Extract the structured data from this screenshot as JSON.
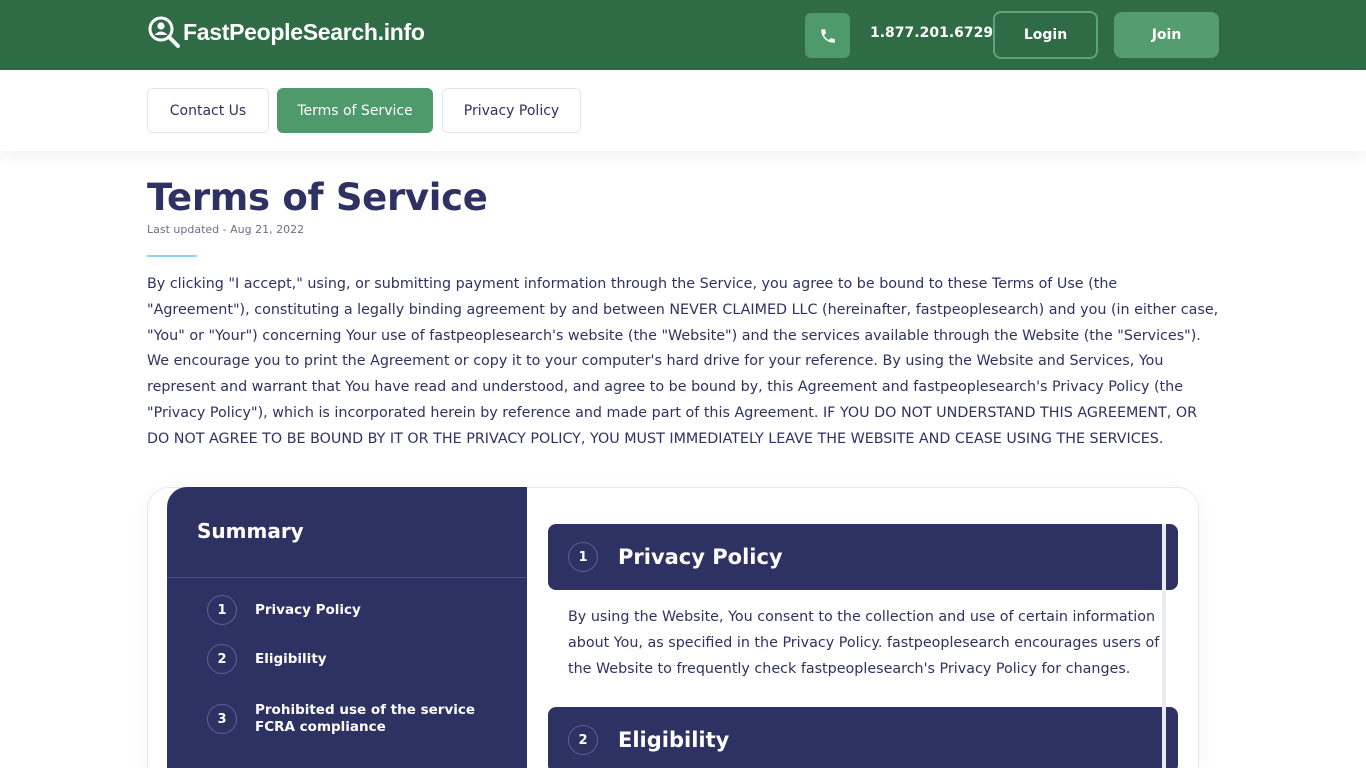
{
  "header": {
    "logo_text": "FastPeopleSearch.info",
    "phone": "1.877.201.6729",
    "login_label": "Login",
    "join_label": "Join",
    "colors": {
      "bg": "#2f6b45",
      "accent": "#4e9a6b"
    }
  },
  "subnav": {
    "tabs": [
      {
        "label": "Contact Us",
        "active": false
      },
      {
        "label": "Terms of Service",
        "active": true
      },
      {
        "label": "Privacy Policy",
        "active": false
      }
    ]
  },
  "content": {
    "title": "Terms of Service",
    "updated": "Last updated - Aug 21, 2022",
    "intro": "By clicking \"I accept,\" using, or submitting payment information through the Service, you agree to be bound to these Terms of Use (the \"Agreement\"), constituting a legally binding agreement by and between NEVER CLAIMED LLC (hereinafter, fastpeoplesearch) and you (in either case, \"You\" or \"Your\") concerning Your use of fastpeoplesearch's website (the \"Website\") and the services available through the Website (the \"Services\"). We encourage you to print the Agreement or copy it to your computer's hard drive for your reference. By using the Website and Services, You represent and warrant that You have read and understood, and agree to be bound by, this Agreement and fastpeoplesearch's Privacy Policy (the \"Privacy Policy\"), which is incorporated herein by reference and made part of this Agreement. IF YOU DO NOT UNDERSTAND THIS AGREEMENT, OR DO NOT AGREE TO BE BOUND BY IT OR THE PRIVACY POLICY, YOU MUST IMMEDIATELY LEAVE THE WEBSITE AND CEASE USING THE SERVICES."
  },
  "summary": {
    "title": "Summary",
    "items": [
      {
        "num": "1",
        "label": "Privacy Policy"
      },
      {
        "num": "2",
        "label": "Eligibility"
      },
      {
        "num": "3",
        "label": "Prohibited use of the service FCRA compliance"
      }
    ]
  },
  "sections": [
    {
      "num": "1",
      "title": "Privacy Policy",
      "body": "By using the Website, You consent to the collection and use of certain information about You, as specified in the Privacy Policy. fastpeoplesearch encourages users of the Website to frequently check fastpeoplesearch's Privacy Policy for changes."
    },
    {
      "num": "2",
      "title": "Eligibility"
    }
  ]
}
